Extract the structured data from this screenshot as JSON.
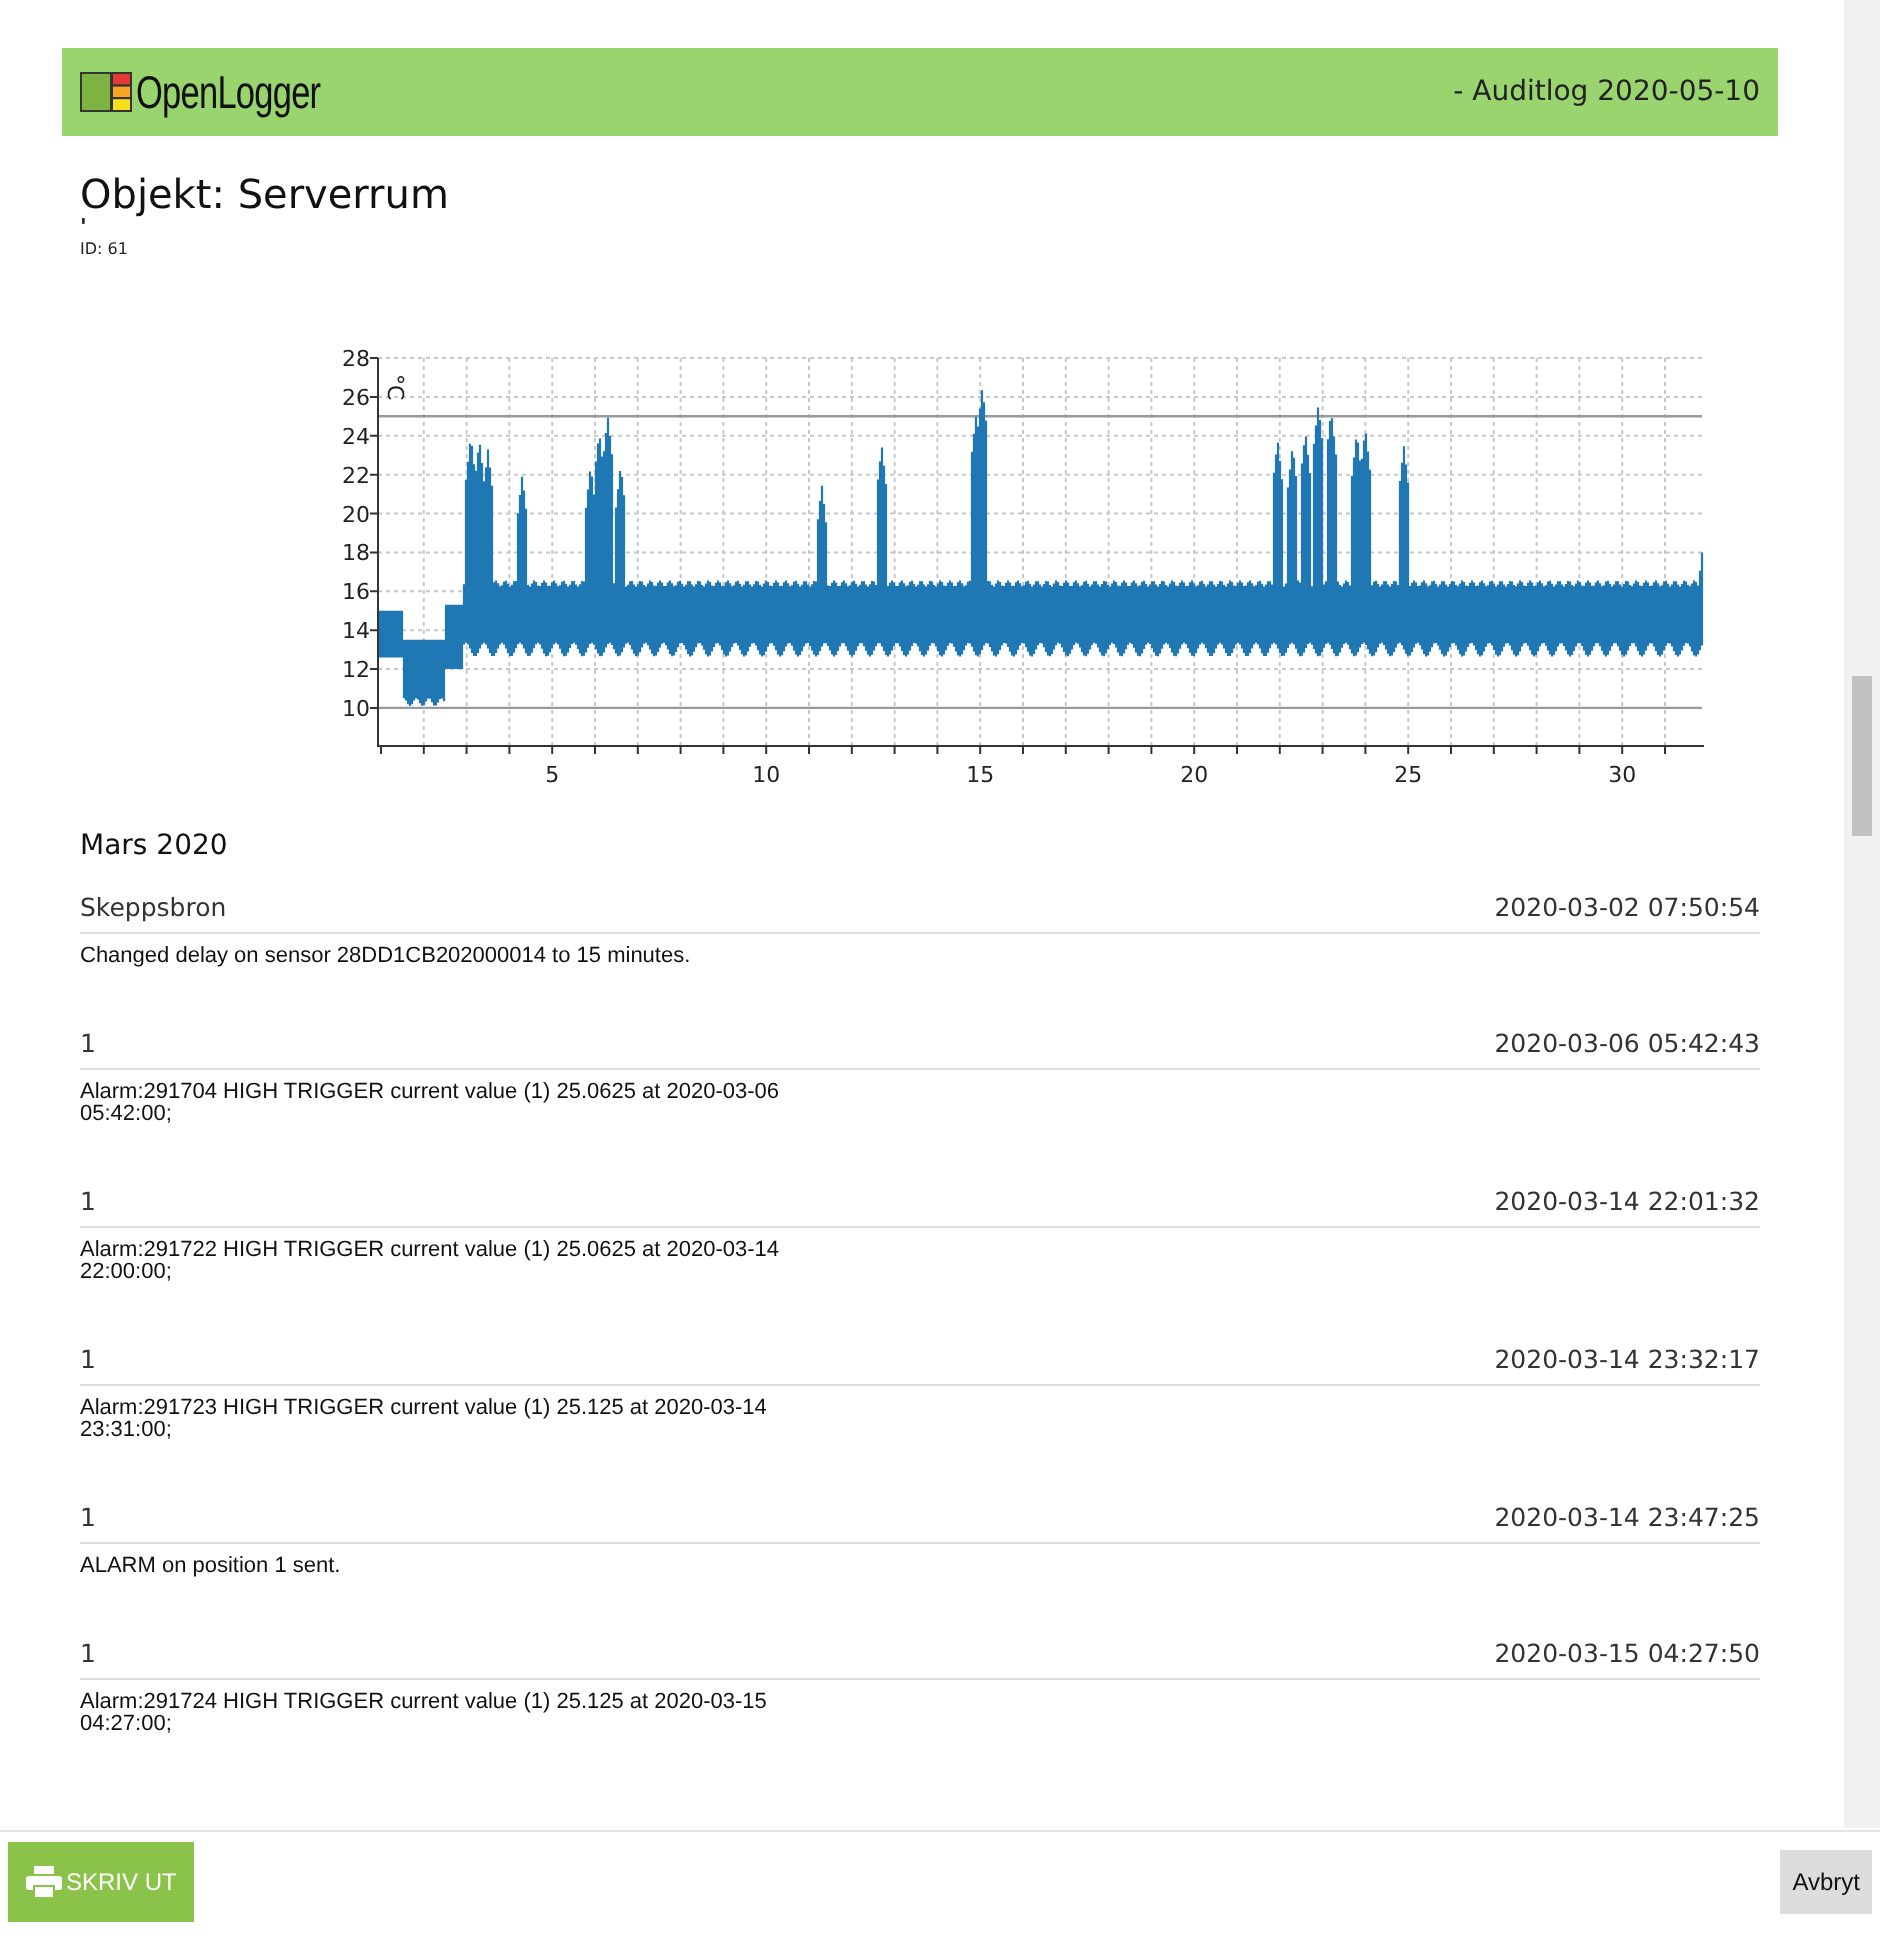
{
  "header": {
    "logo_text": "OpenLogger",
    "subtitle": "- Auditlog 2020-05-10"
  },
  "object": {
    "title": "Objekt: Serverrum",
    "mark": "'",
    "id_label": "ID: 61"
  },
  "chart": {
    "unit": "°C",
    "y_axis_labels": [
      "28",
      "26",
      "24",
      "22",
      "20",
      "18",
      "16",
      "14",
      "12",
      "10"
    ],
    "x_axis_labels": [
      "5",
      "10",
      "15",
      "20",
      "25",
      "30"
    ]
  },
  "month": "Mars 2020",
  "entries": [
    {
      "source": "Skeppsbron",
      "timestamp": "2020-03-02 07:50:54",
      "message": "Changed delay on sensor 28DD1CB202000014 to 15 minutes."
    },
    {
      "source": "1",
      "timestamp": "2020-03-06 05:42:43",
      "message": "Alarm:291704 HIGH TRIGGER current value (1) 25.0625 at 2020-03-06 05:42:00;"
    },
    {
      "source": "1",
      "timestamp": "2020-03-14 22:01:32",
      "message": "Alarm:291722 HIGH TRIGGER current value (1) 25.0625 at 2020-03-14 22:00:00;"
    },
    {
      "source": "1",
      "timestamp": "2020-03-14 23:32:17",
      "message": "Alarm:291723 HIGH TRIGGER current value (1) 25.125 at 2020-03-14 23:31:00;"
    },
    {
      "source": "1",
      "timestamp": "2020-03-14 23:47:25",
      "message": "ALARM on position 1 sent."
    },
    {
      "source": "1",
      "timestamp": "2020-03-15 04:27:50",
      "message": "Alarm:291724 HIGH TRIGGER current value (1) 25.125 at 2020-03-15 04:27:00;"
    }
  ],
  "footer": {
    "print_button": "SKRIV UT",
    "cancel_button": "Avbryt"
  }
}
